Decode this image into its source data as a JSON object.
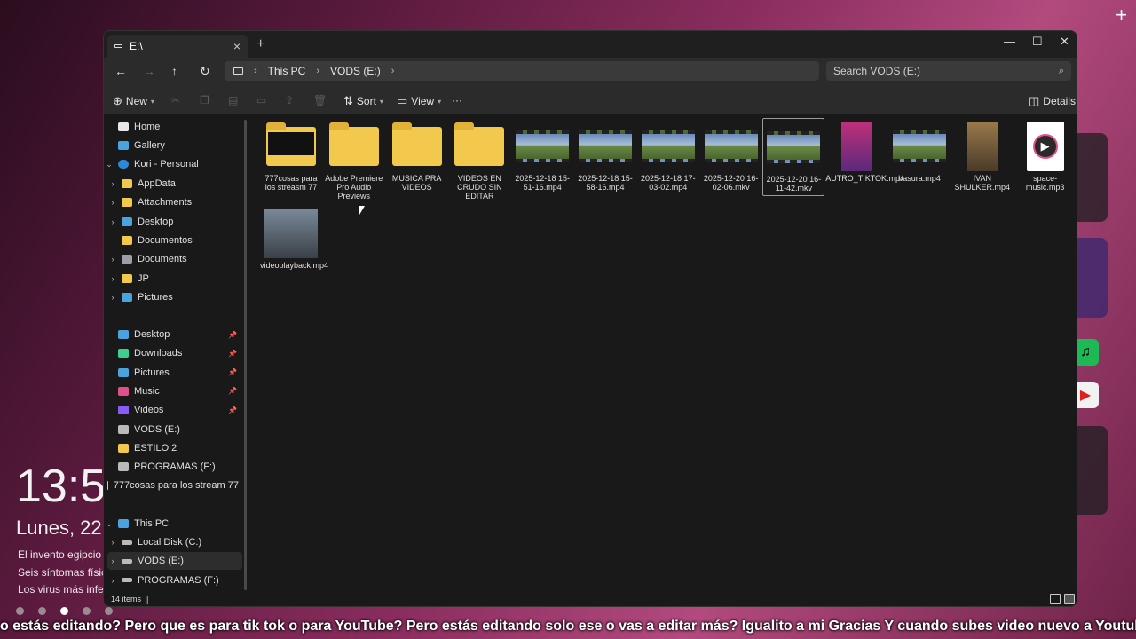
{
  "desktop": {
    "clock": "13:5",
    "date": "Lunes, 22",
    "news": [
      "El invento egipcio c",
      "Seis síntomas físico",
      "Los virus más infec"
    ],
    "plus": "+"
  },
  "window": {
    "tab_title": "E:\\",
    "new_tab": "+",
    "controls": {
      "minimize": "—",
      "maximize": "☐",
      "close": "✕"
    }
  },
  "address": {
    "breadcrumbs": [
      "This PC",
      "VODS (E:)"
    ],
    "search_placeholder": "Search VODS (E:)"
  },
  "toolbar": {
    "new_label": "New",
    "sort_label": "Sort",
    "view_label": "View",
    "more_label": "···",
    "details_label": "Details"
  },
  "sidebar": {
    "top": [
      {
        "label": "Home",
        "icon": "home-icon",
        "color": "#e8e8e8"
      },
      {
        "label": "Gallery",
        "icon": "gallery-icon",
        "color": "#4aa3df"
      }
    ],
    "onedrive": {
      "label": "Kori - Personal",
      "color": "#2b88d8"
    },
    "onedrive_children": [
      {
        "label": "AppData",
        "color": "#f2c94c",
        "expandable": true
      },
      {
        "label": "Attachments",
        "color": "#f2c94c",
        "expandable": true
      },
      {
        "label": "Desktop",
        "color": "#4aa3df",
        "expandable": true
      },
      {
        "label": "Documentos",
        "color": "#f2c94c",
        "expandable": false
      },
      {
        "label": "Documents",
        "color": "#9aa0a6",
        "expandable": true
      },
      {
        "label": "JP",
        "color": "#f2c94c",
        "expandable": true
      },
      {
        "label": "Pictures",
        "color": "#4aa3df",
        "expandable": true
      }
    ],
    "quick_access": [
      {
        "label": "Desktop",
        "color": "#4aa3df",
        "pinned": true
      },
      {
        "label": "Downloads",
        "color": "#3ecf8e",
        "pinned": true
      },
      {
        "label": "Pictures",
        "color": "#4aa3df",
        "pinned": true
      },
      {
        "label": "Music",
        "color": "#e0508a",
        "pinned": true
      },
      {
        "label": "Videos",
        "color": "#8a5cf6",
        "pinned": true
      },
      {
        "label": "VODS (E:)",
        "color": "#bbbbbb",
        "pinned": false
      },
      {
        "label": "ESTILO 2",
        "color": "#f2c94c",
        "pinned": false
      },
      {
        "label": "PROGRAMAS (F:)",
        "color": "#bbbbbb",
        "pinned": false
      },
      {
        "label": "777cosas para los stream 77",
        "color": "#f2c94c",
        "pinned": false
      }
    ],
    "this_pc": {
      "label": "This PC",
      "color": "#4aa3df"
    },
    "drives": [
      {
        "label": "Local Disk (C:)",
        "color": "#bbbbbb",
        "selected": false
      },
      {
        "label": "VODS (E:)",
        "color": "#bbbbbb",
        "selected": true
      },
      {
        "label": "PROGRAMAS (F:)",
        "color": "#bbbbbb",
        "selected": false
      }
    ]
  },
  "files": [
    {
      "name": "777cosas para los streasm 77",
      "kind": "folder-dark"
    },
    {
      "name": "Adobe Premiere Pro Audio Previews",
      "kind": "folder"
    },
    {
      "name": "MUSICA PRA VIDEOS",
      "kind": "folder"
    },
    {
      "name": "VIDEOS EN CRUDO SIN EDITAR",
      "kind": "folder"
    },
    {
      "name": "2025-12-18 15-51-16.mp4",
      "kind": "video"
    },
    {
      "name": "2025-12-18 15-58-16.mp4",
      "kind": "video"
    },
    {
      "name": "2025-12-18 17-03-02.mp4",
      "kind": "video"
    },
    {
      "name": "2025-12-20 16-02-06.mkv",
      "kind": "video"
    },
    {
      "name": "2025-12-20 16-11-42.mkv",
      "kind": "video",
      "selected": true
    },
    {
      "name": "AUTRO_TIKTOK.mp4",
      "kind": "portrait"
    },
    {
      "name": "basura.mp4",
      "kind": "video"
    },
    {
      "name": "IVAN SHULKER.mp4",
      "kind": "portrait-ivan"
    },
    {
      "name": "space-music.mp3",
      "kind": "media"
    },
    {
      "name": "videoplayback.mp4",
      "kind": "wide"
    }
  ],
  "status": {
    "item_count": "14 items",
    "separator": "|"
  },
  "subtitle": "o estás editando? Pero que es para tik tok o para YouTube? Pero estás editando solo ese o vas a editar más? Igualito a mi Gracias Y cuando subes video nuevo a Youtube?"
}
